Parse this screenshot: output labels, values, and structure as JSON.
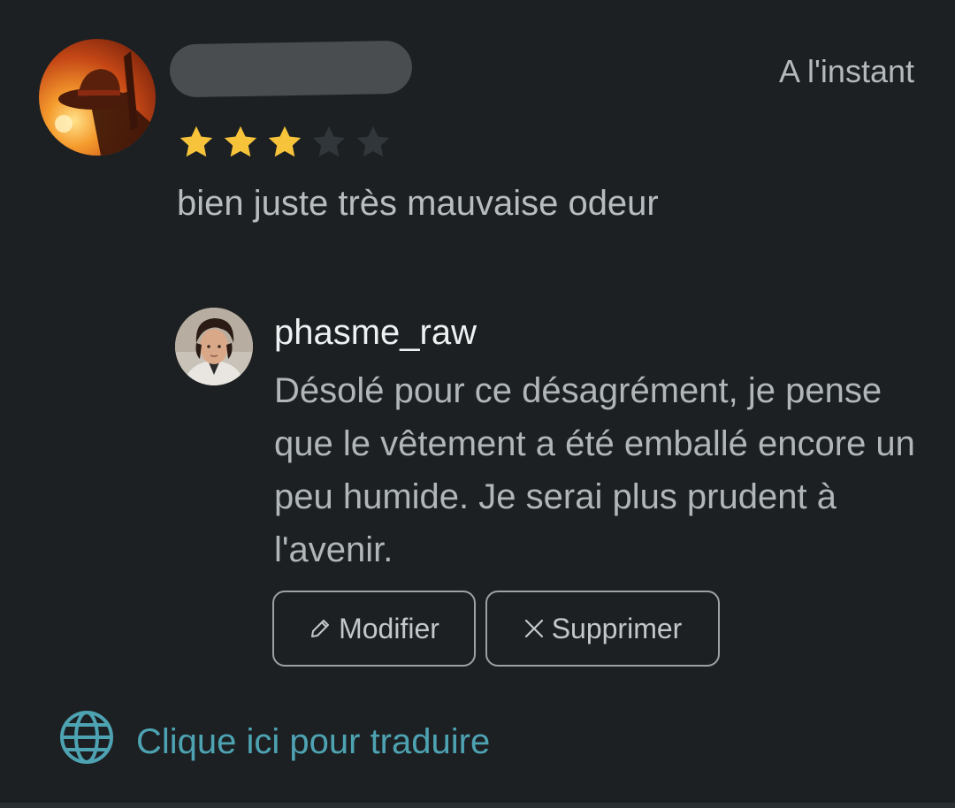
{
  "review": {
    "timestamp": "A l'instant",
    "rating": 3,
    "rating_max": 5,
    "text": "bien juste très mauvaise odeur"
  },
  "reply": {
    "author": "phasme_raw",
    "text": "Désolé pour ce désagrément, je pense que le vêtement a été emballé encore un peu humide. Je serai plus prudent à l'avenir."
  },
  "actions": {
    "edit_label": "Modifier",
    "delete_label": "Supprimer"
  },
  "translate": {
    "label": "Clique ici pour traduire"
  },
  "icons": {
    "edit": "pencil-icon",
    "delete": "close-icon",
    "translate": "globe-icon",
    "star": "star-icon"
  },
  "colors": {
    "background": "#1c2022",
    "star_filled": "#f7c33b",
    "star_empty": "#30363a",
    "link": "#4ea3b3",
    "button_border": "#9ba1a4"
  }
}
